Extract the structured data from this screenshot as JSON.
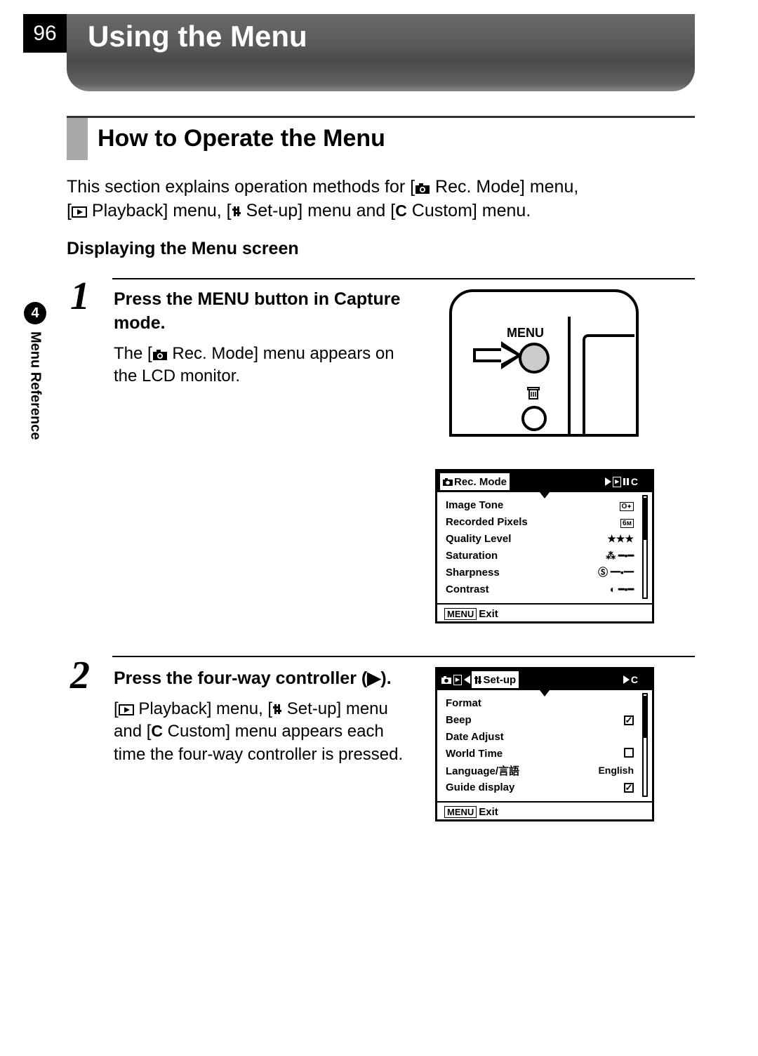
{
  "page_number": "96",
  "chapter_title": "Using the Menu",
  "side_tab": {
    "number": "4",
    "label": "Menu Reference"
  },
  "section_title": "How to Operate the Menu",
  "intro_line1a": "This section explains operation methods for [",
  "intro_line1b": " Rec. Mode] menu,",
  "intro_line2a": "[",
  "intro_line2b": " Playback] menu, [",
  "intro_line2c": " Set-up] menu and [",
  "intro_line2d": " Custom] menu.",
  "subhead": "Displaying the Menu screen",
  "step1": {
    "num": "1",
    "title_a": "Press the ",
    "title_menu": "MENU",
    "title_b": " button in Capture mode.",
    "desc_a": "The [",
    "desc_b": " Rec. Mode] menu appears on the LCD monitor."
  },
  "step2": {
    "num": "2",
    "title": "Press the four-way controller (▶).",
    "desc_a": "[",
    "desc_b": " Playback] menu, [",
    "desc_c": " Set-up] menu and [",
    "desc_d": " Custom] menu appears each time the four-way controller is pressed."
  },
  "camera_illus": {
    "menu_label": "MENU"
  },
  "lcd_rec": {
    "header_active": "Rec. Mode",
    "rows": [
      {
        "label": "Image Tone",
        "value_icon": "box-o"
      },
      {
        "label": "Recorded Pixels",
        "value_icon": "6m"
      },
      {
        "label": "Quality Level",
        "value": "★★★"
      },
      {
        "label": "Saturation",
        "value_icon": "slider-color"
      },
      {
        "label": "Sharpness",
        "value_icon": "slider-s"
      },
      {
        "label": "Contrast",
        "value_icon": "slider-contrast"
      }
    ],
    "footer": "Exit",
    "footer_btn": "MENU"
  },
  "lcd_setup": {
    "header_active": "Set-up",
    "rows": [
      {
        "label": "Format",
        "value": ""
      },
      {
        "label": "Beep",
        "value_icon": "check"
      },
      {
        "label": "Date Adjust",
        "value": ""
      },
      {
        "label": "World Time",
        "value_icon": "uncheck"
      },
      {
        "label": "Language/言語",
        "value": "English"
      },
      {
        "label": "Guide display",
        "value_icon": "check"
      }
    ],
    "footer": "Exit",
    "footer_btn": "MENU"
  },
  "icons": {
    "camera": "📷",
    "play": "▸",
    "setup": "⚙",
    "custom_c": "C",
    "trash": "🗑"
  }
}
